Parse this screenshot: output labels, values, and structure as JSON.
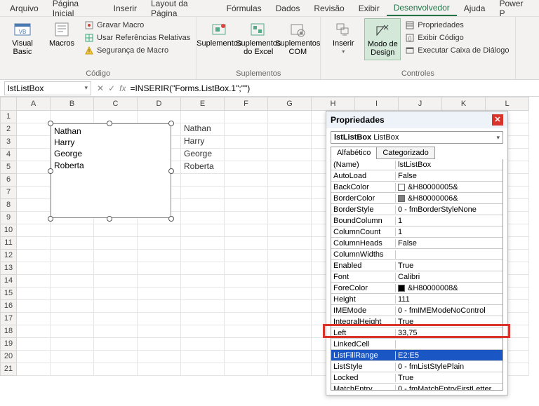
{
  "menu": {
    "items": [
      "Arquivo",
      "Página Inicial",
      "Inserir",
      "Layout da Página",
      "Fórmulas",
      "Dados",
      "Revisão",
      "Exibir",
      "Desenvolvedor",
      "Ajuda",
      "Power P"
    ],
    "active": 8
  },
  "ribbon": {
    "code": {
      "label": "Código",
      "visual": "Visual\nBasic",
      "macros": "Macros",
      "record": "Gravar Macro",
      "refs": "Usar Referências Relativas",
      "security": "Segurança de Macro"
    },
    "addins": {
      "label": "Suplementos",
      "excel": "Suplementos\ndo Excel",
      "com": "Suplementos\nCOM",
      "gen": "Suplementos"
    },
    "controls": {
      "label": "Controles",
      "insert": "Inserir",
      "design": "Modo de\nDesign",
      "props": "Propriedades",
      "code": "Exibir Código",
      "dialog": "Executar Caixa de Diálogo"
    }
  },
  "fx": {
    "name": "lstListBox",
    "formula": "=INSERIR(\"Forms.ListBox.1\";\"\")",
    "x": "✕",
    "chk": "✓",
    "fx": "fx"
  },
  "columns": [
    "A",
    "B",
    "C",
    "D",
    "E",
    "F",
    "G",
    "H",
    "I",
    "J",
    "K",
    "L"
  ],
  "rows": [
    "1",
    "2",
    "3",
    "4",
    "5",
    "6",
    "7",
    "8",
    "9",
    "10",
    "11",
    "12",
    "13",
    "14",
    "15",
    "16",
    "17",
    "18",
    "19",
    "20",
    "21"
  ],
  "colE": {
    "2": "Nathan",
    "3": "Harry",
    "4": "George",
    "5": "Roberta"
  },
  "listbox": {
    "items": [
      "Nathan",
      "Harry",
      "George",
      "Roberta"
    ]
  },
  "props": {
    "title": "Propriedades",
    "combo_name": "lstListBox",
    "combo_type": "ListBox",
    "tabs": [
      "Alfabético",
      "Categorizado"
    ],
    "tab_active": 0,
    "rows": [
      {
        "n": "(Name)",
        "v": "lstListBox"
      },
      {
        "n": "AutoLoad",
        "v": "False"
      },
      {
        "n": "BackColor",
        "v": "&H80000005&",
        "sw": "#ffffff"
      },
      {
        "n": "BorderColor",
        "v": "&H80000006&",
        "sw": "#808080"
      },
      {
        "n": "BorderStyle",
        "v": "0 - fmBorderStyleNone"
      },
      {
        "n": "BoundColumn",
        "v": "1"
      },
      {
        "n": "ColumnCount",
        "v": "1"
      },
      {
        "n": "ColumnHeads",
        "v": "False"
      },
      {
        "n": "ColumnWidths",
        "v": ""
      },
      {
        "n": "Enabled",
        "v": "True"
      },
      {
        "n": "Font",
        "v": "Calibri"
      },
      {
        "n": "ForeColor",
        "v": "&H80000008&",
        "sw": "#000000"
      },
      {
        "n": "Height",
        "v": "111"
      },
      {
        "n": "IMEMode",
        "v": "0 - fmIMEModeNoControl"
      },
      {
        "n": "IntegralHeight",
        "v": "True"
      },
      {
        "n": "Left",
        "v": "33,75"
      },
      {
        "n": "LinkedCell",
        "v": ""
      },
      {
        "n": "ListFillRange",
        "v": "E2:E5",
        "sel": true
      },
      {
        "n": "ListStyle",
        "v": "0 - fmListStylePlain"
      },
      {
        "n": "Locked",
        "v": "True"
      },
      {
        "n": "MatchEntry",
        "v": "0 - fmMatchEntryFirstLetter"
      }
    ]
  },
  "chart_data": null
}
